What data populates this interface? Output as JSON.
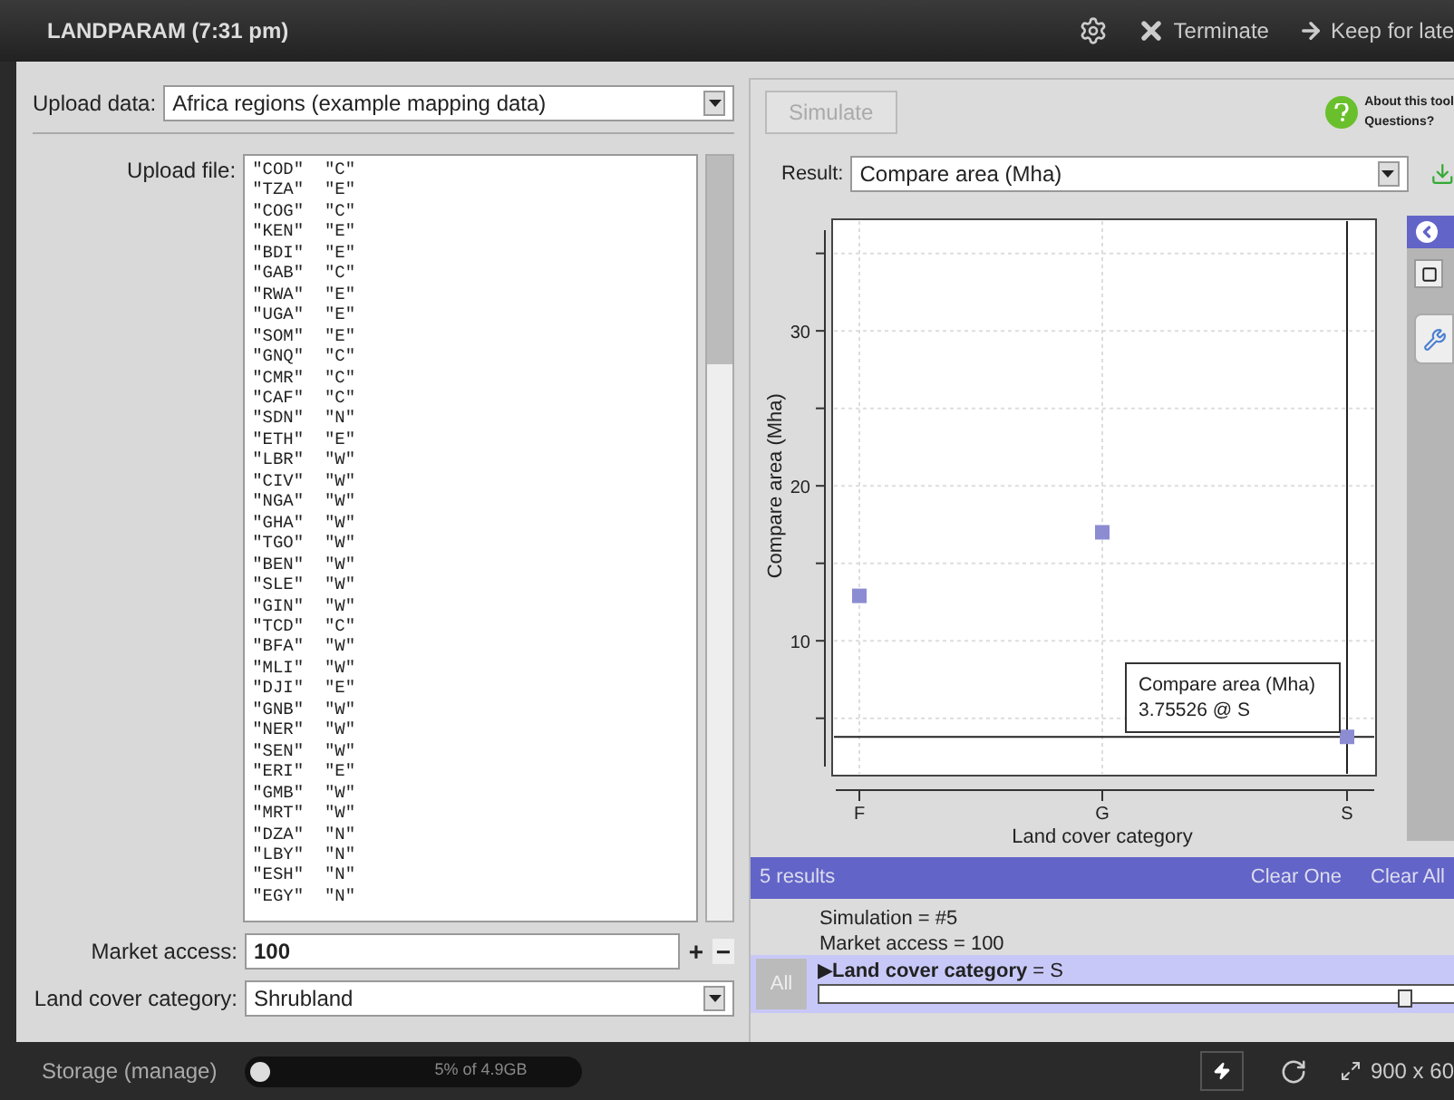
{
  "window": {
    "title": "LANDPARAM (7:31 pm)",
    "actions": [
      {
        "kind": "settings"
      },
      {
        "kind": "terminate",
        "label": "Terminate"
      },
      {
        "kind": "keep",
        "label": "Keep for late"
      }
    ]
  },
  "left": {
    "upload_data": {
      "label": "Upload data:",
      "value": "Africa regions (example mapping data)"
    },
    "upload_file": {
      "label": "Upload file:",
      "lines": [
        "\"COD\"  \"C\"",
        "\"TZA\"  \"E\"",
        "\"COG\"  \"C\"",
        "\"KEN\"  \"E\"",
        "\"BDI\"  \"E\"",
        "\"GAB\"  \"C\"",
        "\"RWA\"  \"E\"",
        "\"UGA\"  \"E\"",
        "\"SOM\"  \"E\"",
        "\"GNQ\"  \"C\"",
        "\"CMR\"  \"C\"",
        "\"CAF\"  \"C\"",
        "\"SDN\"  \"N\"",
        "\"ETH\"  \"E\"",
        "\"LBR\"  \"W\"",
        "\"CIV\"  \"W\"",
        "\"NGA\"  \"W\"",
        "\"GHA\"  \"W\"",
        "\"TGO\"  \"W\"",
        "\"BEN\"  \"W\"",
        "\"SLE\"  \"W\"",
        "\"GIN\"  \"W\"",
        "\"TCD\"  \"C\"",
        "\"BFA\"  \"W\"",
        "\"MLI\"  \"W\"",
        "\"DJI\"  \"E\"",
        "\"GNB\"  \"W\"",
        "\"NER\"  \"W\"",
        "\"SEN\"  \"W\"",
        "\"ERI\"  \"E\"",
        "\"GMB\"  \"W\"",
        "\"MRT\"  \"W\"",
        "\"DZA\"  \"N\"",
        "\"LBY\"  \"N\"",
        "\"ESH\"  \"N\"",
        "\"EGY\"  \"N\""
      ]
    },
    "market_access": {
      "label": "Market access:",
      "value": "100",
      "plus": "+",
      "minus": "−"
    },
    "land_cover": {
      "label": "Land cover category:",
      "value": "Shrubland"
    }
  },
  "right": {
    "simulate": {
      "label": "Simulate",
      "disabled": true
    },
    "help": {
      "about": "About this tool",
      "questions": "Questions?"
    },
    "result": {
      "label": "Result:",
      "value": "Compare area (Mha)"
    },
    "chart_data": {
      "type": "scatter",
      "xlabel": "Land cover category",
      "ylabel": "Compare area (Mha)",
      "categories": [
        "F",
        "G",
        "S"
      ],
      "series": [
        {
          "name": "Compare area (Mha)",
          "color": "#8c8cd2",
          "values": [
            12.9,
            17.0,
            3.8
          ]
        }
      ],
      "ylim": [
        1.3,
        37.2
      ],
      "yticks": [
        10,
        20,
        30
      ],
      "grid": true,
      "ref_lines": [
        {
          "axis": "y",
          "value": 3.8
        },
        {
          "axis": "x",
          "value": "S"
        }
      ]
    },
    "tooltip": {
      "value": "3.75526 @ S"
    },
    "results_bar": {
      "count": "5 results",
      "clear_one": "Clear One",
      "clear_all": "Clear All"
    },
    "results": [
      {
        "text": "Simulation = #5",
        "selected": false
      },
      {
        "text": "Market access = 100",
        "selected": false
      },
      {
        "text": "**Land cover category** = S",
        "selected": true,
        "marker": "▶"
      }
    ],
    "all_button": "All",
    "slider": {
      "level": 0.92
    }
  },
  "status_bar": {
    "storage": "Storage (manage)",
    "usage": {
      "text": "5% of 4.9GB",
      "level": 0.05
    },
    "size": "900 x 60"
  }
}
